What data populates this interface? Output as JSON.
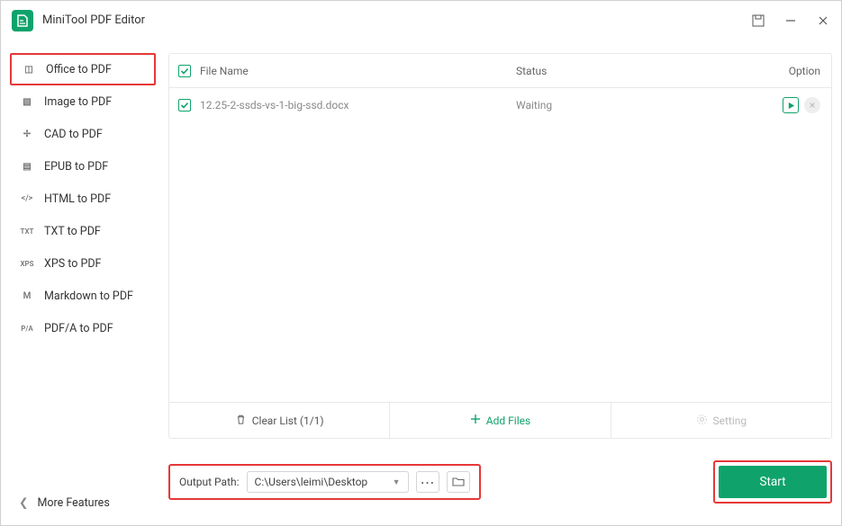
{
  "app_title": "MiniTool PDF Editor",
  "sidebar": {
    "items": [
      {
        "label": "Office to PDF",
        "icon": "office-icon"
      },
      {
        "label": "Image to PDF",
        "icon": "image-icon"
      },
      {
        "label": "CAD to PDF",
        "icon": "cad-icon"
      },
      {
        "label": "EPUB to PDF",
        "icon": "epub-icon"
      },
      {
        "label": "HTML to PDF",
        "icon": "html-icon"
      },
      {
        "label": "TXT to PDF",
        "icon": "txt-icon"
      },
      {
        "label": "XPS to PDF",
        "icon": "xps-icon"
      },
      {
        "label": "Markdown to PDF",
        "icon": "markdown-icon"
      },
      {
        "label": "PDF/A to PDF",
        "icon": "pdfa-icon"
      }
    ],
    "more_label": "More Features"
  },
  "table": {
    "headers": {
      "name": "File Name",
      "status": "Status",
      "option": "Option"
    },
    "rows": [
      {
        "name": "12.25-2-ssds-vs-1-big-ssd.docx",
        "status": "Waiting"
      }
    ]
  },
  "footer": {
    "clear_label": "Clear List (1/1)",
    "add_label": "Add Files",
    "setting_label": "Setting"
  },
  "output": {
    "label": "Output Path:",
    "value": "C:\\Users\\leimi\\Desktop"
  },
  "start_label": "Start",
  "icon_text": {
    "office": "◫",
    "image": "▧",
    "cad": "✢",
    "epub": "▤",
    "html": "</>",
    "txt": "TXT",
    "xps": "XPS",
    "markdown": "M",
    "pdfa": "P/A"
  }
}
